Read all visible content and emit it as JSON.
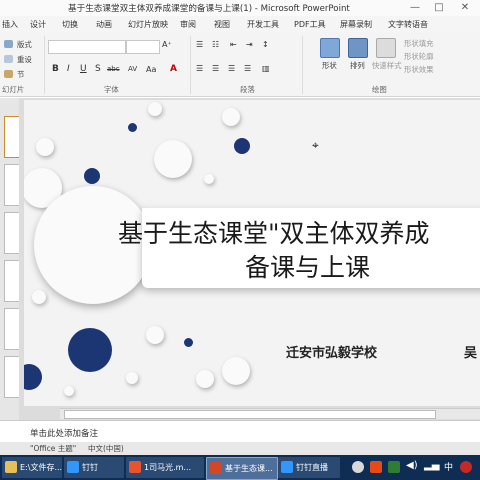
{
  "window": {
    "title": "基于生态课堂双主体双养成课堂的备课与上课(1) - Microsoft PowerPoint",
    "minimize": "—",
    "maximize": "□",
    "close": "✕"
  },
  "menu_tabs": [
    "插入",
    "设计",
    "切换",
    "动画",
    "幻灯片放映",
    "审阅",
    "视图",
    "开发工具",
    "PDF工具",
    "屏幕录制",
    "文字转语音"
  ],
  "ribbon": {
    "clipboard_items": [
      "版式",
      "重设",
      "节"
    ],
    "group_slides": "幻灯片",
    "group_font": "字体",
    "group_paragraph": "段落",
    "group_drawing": "绘图",
    "font_buttons": [
      "B",
      "I",
      "U",
      "S",
      "abc",
      "AV",
      "Aa",
      "A"
    ],
    "drawing_labels": [
      "形状",
      "排列",
      "快速样式"
    ],
    "shape_options": [
      "形状填充",
      "形状轮廓",
      "形状效果"
    ]
  },
  "slide": {
    "title_line1": "基于生态课堂\"双主体双养成",
    "title_line2": "备课与上课",
    "school": "迁安市弘毅学校",
    "author": "吴"
  },
  "notes": {
    "placeholder": "单击此处添加备注"
  },
  "status": {
    "theme": "\"Office 主题\"",
    "language": "中文(中国)"
  },
  "taskbar": {
    "items": [
      "E:\\文件存...",
      "钉钉",
      "1司马光.m...",
      "基于生态课...",
      "钉钉直播"
    ],
    "tray": [
      "中"
    ]
  },
  "colors": {
    "accent_blue": "#1c3573",
    "taskbar": "#0f2d52",
    "slide_bg": "#f3f3f3"
  }
}
